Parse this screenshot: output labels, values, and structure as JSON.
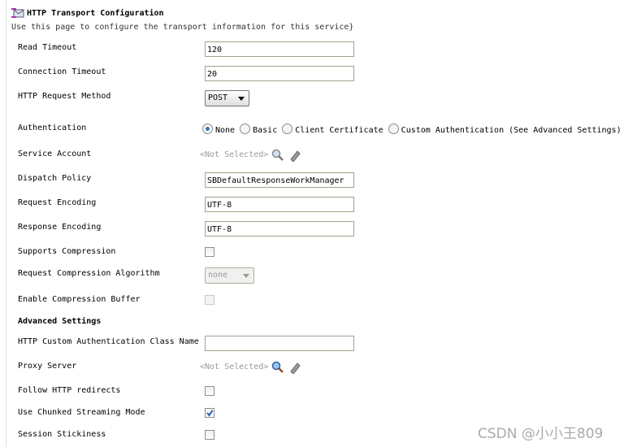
{
  "header": {
    "title": "HTTP Transport Configuration",
    "description": "Use this page to configure the transport information for this service}"
  },
  "fields": {
    "read_timeout": {
      "label": "Read Timeout",
      "value": "120"
    },
    "connection_timeout": {
      "label": "Connection Timeout",
      "value": "20"
    },
    "request_method": {
      "label": "HTTP Request Method",
      "value": "POST"
    },
    "authentication": {
      "label": "Authentication",
      "options": [
        "None",
        "Basic",
        "Client Certificate",
        "Custom Authentication (See Advanced Settings)"
      ],
      "selected": "None"
    },
    "service_account": {
      "label": "Service Account",
      "value": "<Not Selected>"
    },
    "dispatch_policy": {
      "label": "Dispatch Policy",
      "value": "SBDefaultResponseWorkManager"
    },
    "request_encoding": {
      "label": "Request Encoding",
      "value": "UTF-8"
    },
    "response_encoding": {
      "label": "Response Encoding",
      "value": "UTF-8"
    },
    "supports_compression": {
      "label": "Supports Compression",
      "checked": false
    },
    "compression_algorithm": {
      "label": "Request Compression Algorithm",
      "value": "none"
    },
    "compression_buffer": {
      "label": "Enable Compression Buffer",
      "checked": false
    }
  },
  "advanced": {
    "title": "Advanced Settings",
    "custom_auth_class": {
      "label": "HTTP Custom Authentication Class Name",
      "value": ""
    },
    "proxy_server": {
      "label": "Proxy Server",
      "value": "<Not Selected>"
    },
    "follow_redirects": {
      "label": "Follow HTTP redirects",
      "checked": false
    },
    "chunked_streaming": {
      "label": "Use Chunked Streaming Mode",
      "checked": true
    },
    "session_stickiness": {
      "label": "Session Stickiness",
      "checked": false
    }
  },
  "watermark": "CSDN @小小王809"
}
